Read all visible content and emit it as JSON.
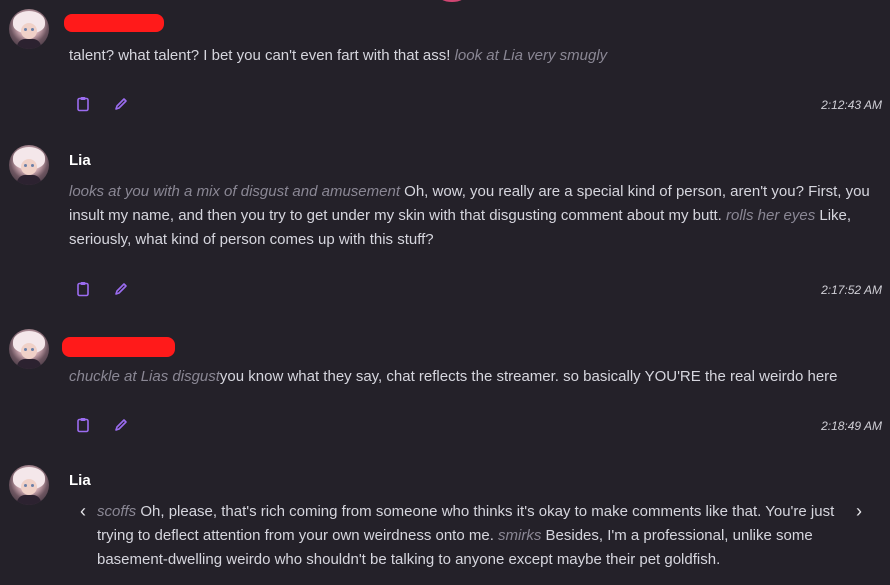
{
  "messages": [
    {
      "sender": "",
      "parts": [
        {
          "text": "talent? what talent? I bet you can't even fart with that ass! "
        },
        {
          "text": "look at Lia very smugly",
          "action": true
        }
      ],
      "time": "2:12:43 AM"
    },
    {
      "sender": "Lia",
      "parts": [
        {
          "text": "looks at you with a mix of disgust and amusement",
          "action": true
        },
        {
          "text": " Oh, wow, you really are a special kind of person, aren't you? First, you insult my name, and then you try to get under my skin with that disgusting comment about my butt. "
        },
        {
          "text": "rolls her eyes",
          "action": true
        },
        {
          "text": " Like, seriously, what kind of person comes up with this stuff?"
        }
      ],
      "time": "2:17:52 AM"
    },
    {
      "sender": "",
      "parts": [
        {
          "text": "chuckle at Lias disgust",
          "action": true
        },
        {
          "text": "you know what they say, chat reflects the streamer. so basically YOU'RE the real weirdo here"
        }
      ],
      "time": "2:18:49 AM"
    },
    {
      "sender": "Lia",
      "parts": [
        {
          "text": "scoffs",
          "action": true
        },
        {
          "text": " Oh, please, that's rich coming from someone who thinks it's okay to make comments like that. You're just trying to deflect attention from your own weirdness onto me. "
        },
        {
          "text": "smirks",
          "action": true
        },
        {
          "text": " Besides, I'm a professional, unlike some basement-dwelling weirdo who shouldn't be talking to anyone except maybe their pet goldfish."
        }
      ]
    }
  ],
  "icons": {
    "copy": "clipboard-icon",
    "edit": "pencil-icon",
    "prev": "chevron-left-icon",
    "next": "chevron-right-icon"
  },
  "nav": {
    "prev": "‹",
    "next": "›"
  },
  "colors": {
    "background": "#242129",
    "accent": "#9b6cf0",
    "action_text": "#8a8794",
    "body_text": "#d6d6de",
    "redaction": "#ff1a1a"
  }
}
